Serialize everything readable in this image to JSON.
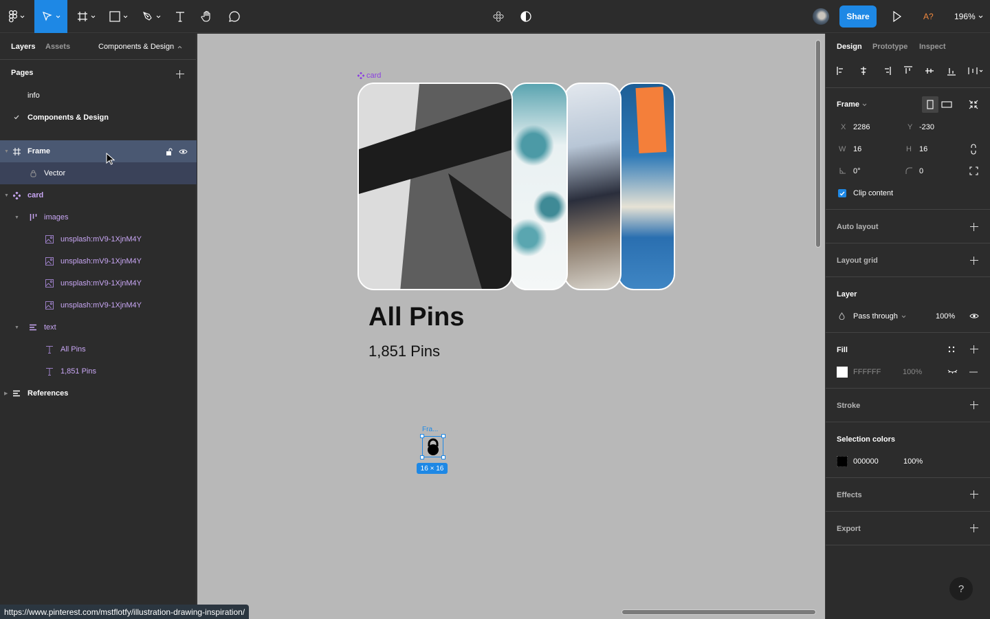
{
  "toolbar": {
    "tools": [
      "main-menu",
      "move",
      "frame",
      "rectangle",
      "pen",
      "text",
      "hand",
      "comment"
    ],
    "active_tool": "move",
    "center_icons": [
      "components-icon",
      "contrast-icon"
    ],
    "share_label": "Share",
    "missing_fonts_label": "A?",
    "zoom_level": "196%"
  },
  "left_panel": {
    "tabs": [
      "Layers",
      "Assets"
    ],
    "active_tab": "Layers",
    "current_page_label": "Components & Design",
    "pages_heading": "Pages",
    "pages": [
      {
        "label": "info",
        "current": false
      },
      {
        "label": "Components & Design",
        "current": true
      }
    ],
    "layers": [
      {
        "name": "Frame",
        "type": "frame",
        "depth": 0,
        "selected": true
      },
      {
        "name": "Vector",
        "type": "vector",
        "depth": 1,
        "selected": false
      },
      {
        "name": "card",
        "type": "component",
        "depth": 0
      },
      {
        "name": "images",
        "type": "autolayout",
        "depth": 1
      },
      {
        "name": "unsplash:mV9-1XjnM4Y",
        "type": "image",
        "depth": 2
      },
      {
        "name": "unsplash:mV9-1XjnM4Y",
        "type": "image",
        "depth": 2
      },
      {
        "name": "unsplash:mV9-1XjnM4Y",
        "type": "image",
        "depth": 2
      },
      {
        "name": "unsplash:mV9-1XjnM4Y",
        "type": "image",
        "depth": 2
      },
      {
        "name": "text",
        "type": "autolayout-vertical",
        "depth": 1
      },
      {
        "name": "All Pins",
        "type": "text",
        "depth": 2
      },
      {
        "name": "1,851 Pins",
        "type": "text",
        "depth": 2
      },
      {
        "name": "References",
        "type": "group",
        "depth": 0
      }
    ]
  },
  "canvas": {
    "component_label": "card",
    "card_title": "All Pins",
    "card_subtitle": "1,851 Pins",
    "selection_label": "Fra...",
    "selection_size": "16 × 16",
    "accent": "#1e88e5",
    "component_color": "#8b3fe0"
  },
  "status_url": "https://www.pinterest.com/mstflotfy/illustration-drawing-inspiration/",
  "right_panel": {
    "tabs": [
      "Design",
      "Prototype",
      "Inspect"
    ],
    "active_tab": "Design",
    "frame_label": "Frame",
    "x_label": "X",
    "x": "2286",
    "y_label": "Y",
    "y": "-230",
    "w_label": "W",
    "w": "16",
    "h_label": "H",
    "h": "16",
    "rotation": "0°",
    "radius": "0",
    "clip_content_label": "Clip content",
    "clip_content": true,
    "auto_layout": "Auto layout",
    "layout_grid": "Layout grid",
    "layer_heading": "Layer",
    "blend_mode": "Pass through",
    "layer_opacity": "100%",
    "fill_heading": "Fill",
    "fill_hex": "FFFFFF",
    "fill_opacity": "100%",
    "stroke": "Stroke",
    "selection_colors": "Selection colors",
    "selection_color_hex": "000000",
    "selection_color_opacity": "100%",
    "effects": "Effects",
    "export": "Export",
    "help": "?"
  }
}
